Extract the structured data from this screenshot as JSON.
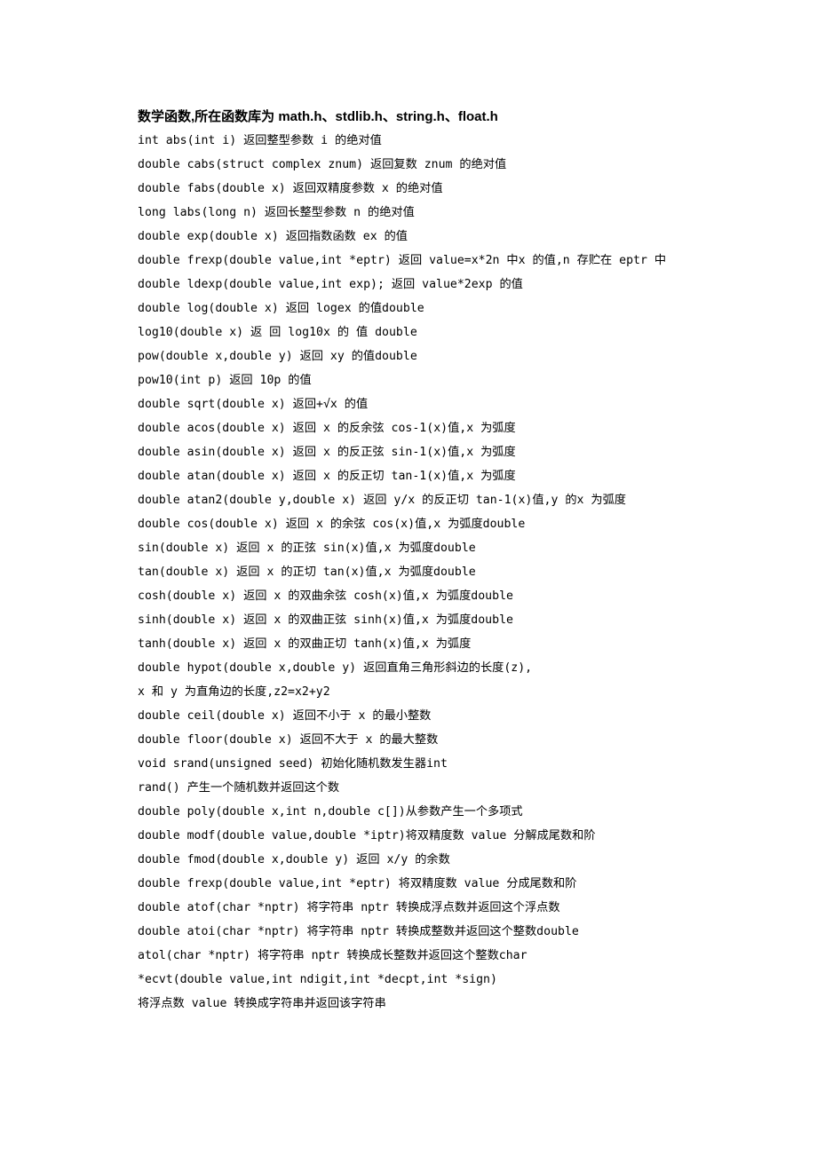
{
  "title": "数学函数,所在函数库为 math.h、stdlib.h、string.h、float.h",
  "lines": [
    "int abs(int i) 返回整型参数 i 的绝对值",
    "double cabs(struct complex znum) 返回复数 znum 的绝对值",
    "double fabs(double x) 返回双精度参数 x 的绝对值",
    "long labs(long n) 返回长整型参数 n 的绝对值",
    "double exp(double x) 返回指数函数 ex 的值",
    "double frexp(double value,int *eptr) 返回 value=x*2n 中x 的值,n 存贮在 eptr 中",
    "double ldexp(double value,int exp); 返回 value*2exp 的值",
    "double log(double x) 返回 logex 的值double",
    "log10(double x) 返 回 log10x 的 值 double",
    "pow(double x,double y) 返回 xy 的值double",
    "pow10(int p) 返回 10p 的值",
    "double sqrt(double x) 返回+√x 的值",
    "double acos(double x) 返回 x 的反余弦 cos-1(x)值,x 为弧度",
    "double asin(double x) 返回 x 的反正弦 sin-1(x)值,x 为弧度",
    "double atan(double x) 返回 x 的反正切 tan-1(x)值,x 为弧度",
    "double atan2(double y,double x) 返回 y/x 的反正切 tan-1(x)值,y 的x 为弧度",
    "double cos(double x) 返回 x 的余弦 cos(x)值,x 为弧度double",
    "sin(double x) 返回 x 的正弦 sin(x)值,x 为弧度double",
    "tan(double x) 返回 x 的正切 tan(x)值,x 为弧度double",
    "cosh(double x) 返回 x 的双曲余弦 cosh(x)值,x 为弧度double",
    "sinh(double x) 返回 x 的双曲正弦 sinh(x)值,x 为弧度double",
    "tanh(double x) 返回 x 的双曲正切 tanh(x)值,x 为弧度",
    "double hypot(double x,double y) 返回直角三角形斜边的长度(z),",
    "x 和 y 为直角边的长度,z2=x2+y2",
    "double ceil(double x) 返回不小于 x 的最小整数",
    "double floor(double x) 返回不大于 x 的最大整数",
    "void srand(unsigned seed) 初始化随机数发生器int",
    "rand() 产生一个随机数并返回这个数",
    "double poly(double x,int n,double c[])从参数产生一个多项式",
    "double modf(double value,double *iptr)将双精度数 value 分解成尾数和阶",
    "double fmod(double x,double y) 返回 x/y 的余数",
    "double frexp(double value,int *eptr) 将双精度数 value 分成尾数和阶",
    "double atof(char *nptr) 将字符串 nptr 转换成浮点数并返回这个浮点数",
    "double atoi(char *nptr) 将字符串 nptr 转换成整数并返回这个整数double",
    "atol(char *nptr) 将字符串 nptr 转换成长整数并返回这个整数char",
    "*ecvt(double value,int ndigit,int *decpt,int *sign)",
    "将浮点数 value 转换成字符串并返回该字符串"
  ]
}
